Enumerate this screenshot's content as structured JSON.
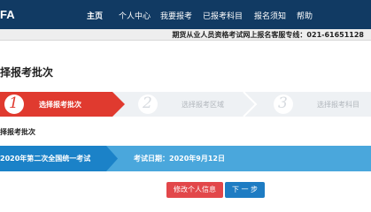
{
  "header": {
    "logo_text": "FA",
    "nav": [
      {
        "label": "主页"
      },
      {
        "label": "个人中心"
      },
      {
        "label": "我要报考"
      },
      {
        "label": "已报考科目"
      },
      {
        "label": "报名须知"
      },
      {
        "label": "帮助"
      }
    ]
  },
  "hotline": "期货从业人员资格考试网上报名客服专线：021-61651128",
  "page_title": "择报考批次",
  "steps": [
    {
      "number": "1",
      "label": "选择报考批次",
      "active": true
    },
    {
      "number": "2",
      "label": "选择报考区域",
      "active": false
    },
    {
      "number": "3",
      "label": "选择报考科目",
      "active": false
    }
  ],
  "section_label": "择报考批次",
  "batch": {
    "name": "2020年第二次全国统一考试",
    "date": "考试日期：2020年9月12日"
  },
  "buttons": {
    "edit_label": "修改个人信息",
    "next_label": "下 一 步"
  },
  "colors": {
    "nav_bg": "#113a63",
    "step_active": "#e03a2f",
    "batch_tab": "#1b82c8",
    "batch_row": "#4aa7dc",
    "edit_button": "#e2474a",
    "next_button": "#1e7cc3"
  }
}
